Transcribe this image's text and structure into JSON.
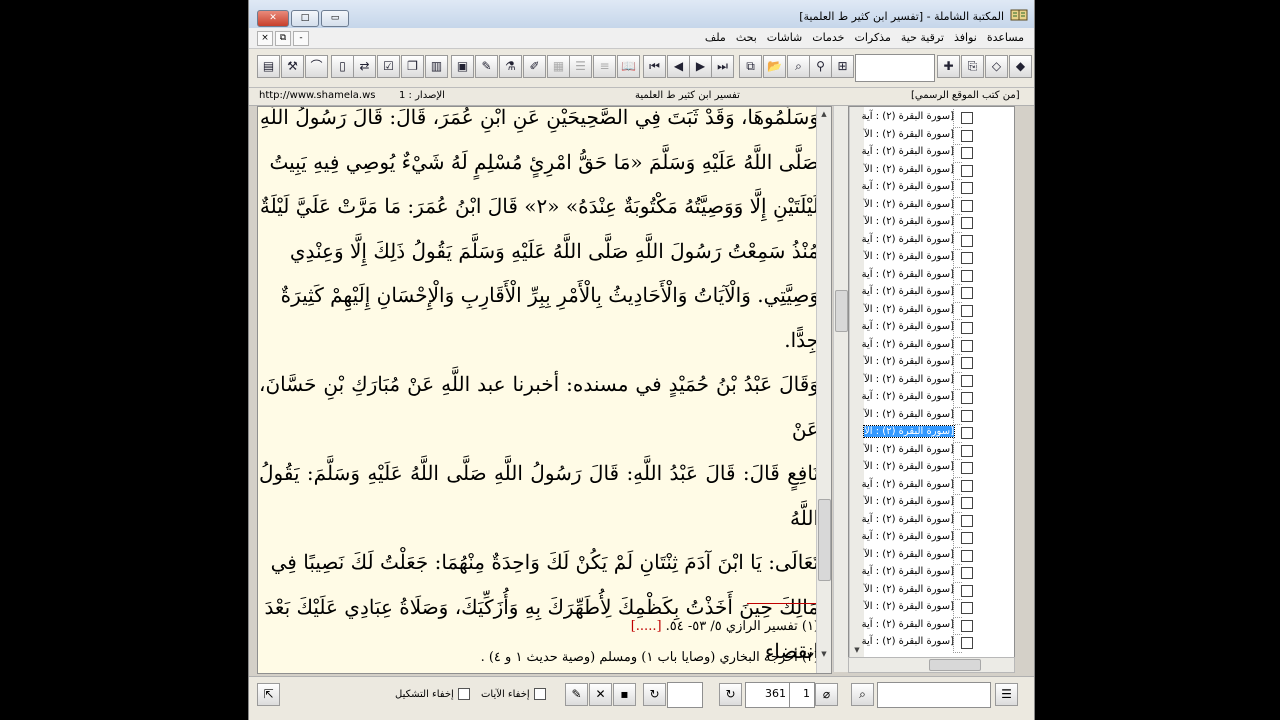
{
  "window": {
    "title": "المكتبة الشاملة - [تفسير ابن كثير ط العلمية]",
    "controls": {
      "close": "✕",
      "maximize": "□",
      "minimize": "▭"
    }
  },
  "menu": {
    "items": [
      "ملف",
      "بحث",
      "شاشات",
      "خدمات",
      "مذكرات",
      "ترقية حية",
      "نوافذ",
      "مساعدة"
    ],
    "mdi": {
      "close": "×",
      "restore": "⧉",
      "minimize": "-"
    }
  },
  "infobar": {
    "url": "http://www.shamela.ws",
    "edition": "الإصدار : 1",
    "book": "تفسير ابن كثير ط العلمية",
    "source": "[من كتب الموقع الرسمي]"
  },
  "content": {
    "lines": [
      "وَسَلَّمُوهَا، وَقَدْ ثَبَتَ فِي الصَّحِيحَيْنِ عَنِ ابْنِ عُمَرَ، قَالَ: قَالَ رَسُولُ اللَّهِ",
      "صَلَّى اللَّهُ عَلَيْهِ وَسَلَّمَ «مَا حَقُّ امْرِئٍ مُسْلِمٍ لَهُ شَيْءٌ يُوصِي فِيهِ يَبِيتُ",
      "لَيْلَتَيْنِ إِلَّا وَوَصِيَّتُهُ مَكْتُوبَةٌ عِنْدَهُ» «٢» قَالَ ابْنُ عُمَرَ: مَا مَرَّتْ عَلَيَّ لَيْلَةٌ",
      "مُنْذُ سَمِعْتُ رَسُولَ اللَّهِ صَلَّى اللَّهُ عَلَيْهِ وَسَلَّمَ يَقُولُ ذَلِكَ إِلَّا وَعِنْدِي",
      "وَصِيَّتِي. وَالْآيَاتُ وَالْأَحَادِيثُ بِالْأَمْرِ بِبِرِّ الْأَقَارِبِ وَالْإِحْسَانِ إِلَيْهِمْ كَثِيرَةٌ",
      "جِدًّا.",
      "وَقَالَ عَبْدُ بْنُ حُمَيْدٍ في مسنده: أخبرنا عبد اللَّهِ عَنْ مُبَارَكِ بْنِ حَسَّانَ، عَنْ",
      "نَافِعٍ قَالَ: قَالَ عَبْدُ اللَّهِ: قَالَ رَسُولُ اللَّهِ صَلَّى اللَّهُ عَلَيْهِ وَسَلَّمَ: يَقُولُ اللَّهُ",
      "تَعَالَى: يَا ابْنَ آدَمَ ثِنْتَانِ لَمْ يَكُنْ لَكَ وَاحِدَةٌ مِنْهُمَا: جَعَلْتُ لَكَ نَصِيبًا فِي",
      "مَالِكَ حِينَ أَخَذْتُ بِكَظْمِكَ لِأُطَهِّرَكَ بِهِ وَأُزَكِّيَكَ، وَصَلَاةُ عِبَادِي عَلَيْكَ بَعْدَ",
      "انقضاء"
    ],
    "footnotes": [
      {
        "text": "(١) تفسير الرازي ٥/ ٥٣- ٥٤. ",
        "link": "[.....]"
      },
      {
        "text": "(٢) أخرجه البخاري (وصايا باب ١) ومسلم (وصية حديث ١ و ٤) .",
        "link": ""
      }
    ]
  },
  "tree": {
    "labels": [
      "[سورة البقرة (٢) : آية",
      "[سورة البقرة (٢) : الآ",
      "[سورة البقرة (٢) : آية",
      "[سورة البقرة (٢) : الآ",
      "[سورة البقرة (٢) : آية",
      "[سورة البقرة (٢) : الآ",
      "[سورة البقرة (٢) : الآ",
      "[سورة البقرة (٢) : آية",
      "[سورة البقرة (٢) : الآ",
      "[سورة البقرة (٢) : آية",
      "[سورة البقرة (٢) : آية",
      "[سورة البقرة (٢) : الآ",
      "[سورة البقرة (٢) : آية",
      "[سورة البقرة (٢) : آية",
      "[سورة البقرة (٢) : الآ",
      "[سورة البقرة (٢) : الآ",
      "[سورة البقرة (٢) : آية",
      "[سورة البقرة (٢) : الآ",
      "[سورة البقرة (٢) : الآ",
      "[سورة البقرة (٢) : الآ",
      "[سورة البقرة (٢) : الآ",
      "[سورة البقرة (٢) : آية",
      "[سورة البقرة (٢) : الآ",
      "[سورة البقرة (٢) : آية",
      "[سورة البقرة (٢) : آية",
      "[سورة البقرة (٢) : الآ",
      "[سورة البقرة (٢) : آية",
      "[سورة البقرة (٢) : الآ",
      "[سورة البقرة (٢) : الآ",
      "[سورة البقرة (٢) : آية",
      "[سورة البقرة (٢) : آية"
    ],
    "selected_index": 18
  },
  "bottombar": {
    "page_number": "361",
    "part_number": "1",
    "hide_verses_label": "إخفاء الآيات",
    "hide_diacritics_label": "إخفاء التشكيل"
  }
}
